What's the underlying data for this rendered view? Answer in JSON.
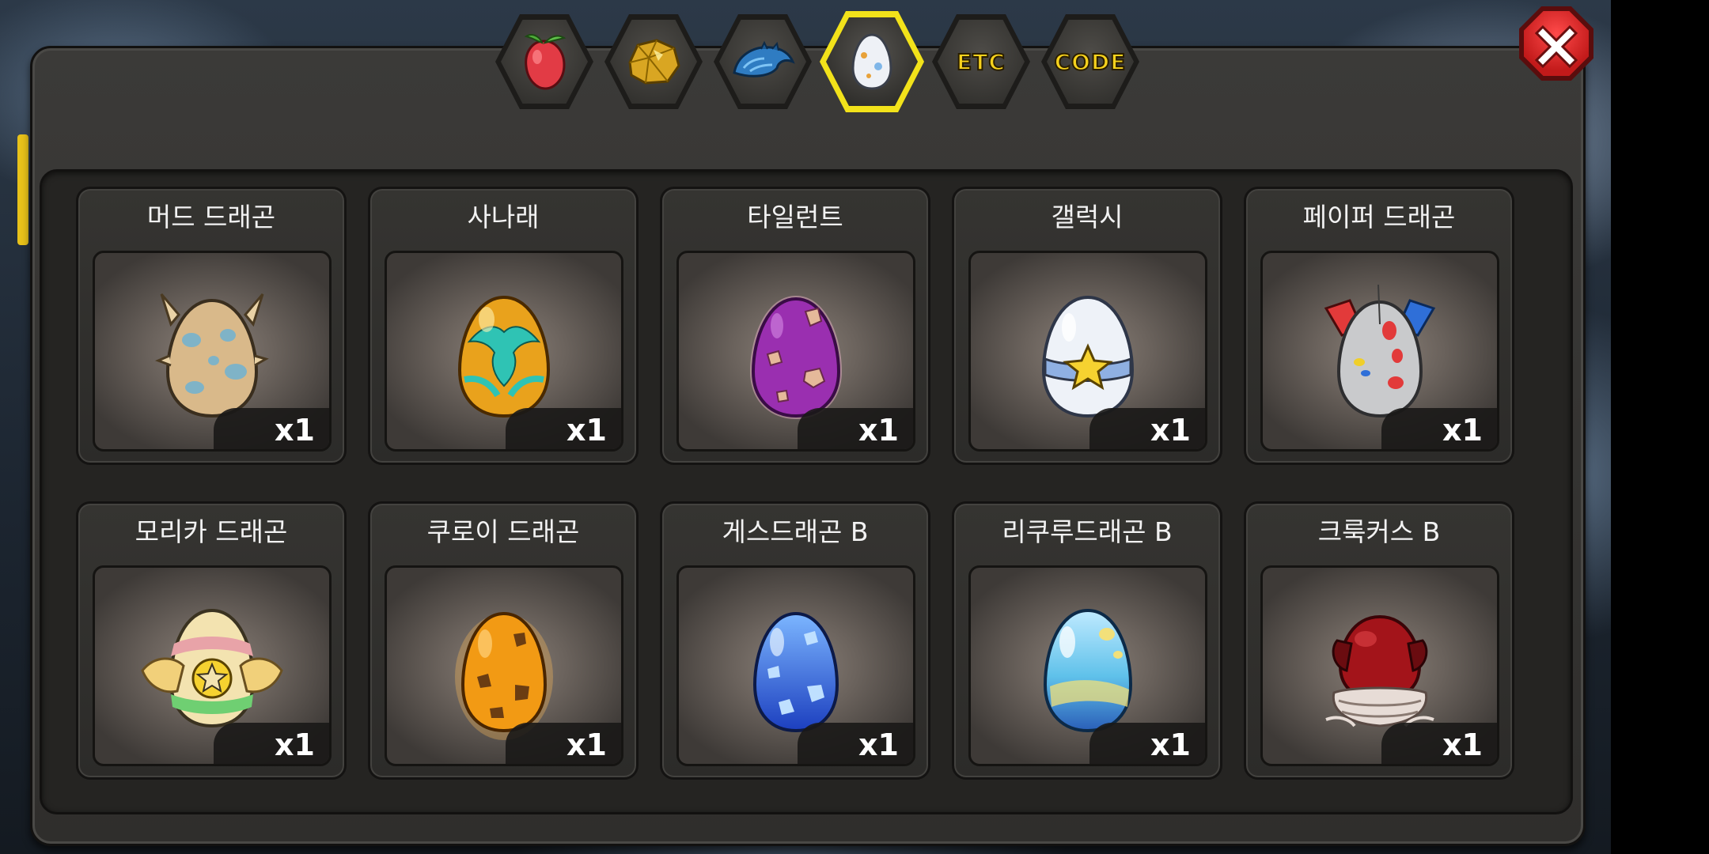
{
  "tabs": [
    {
      "icon": "fruit-icon",
      "label": "",
      "active": false
    },
    {
      "icon": "gold-nugget-icon",
      "label": "",
      "active": false
    },
    {
      "icon": "dragon-scale-icon",
      "label": "",
      "active": false
    },
    {
      "icon": "egg-icon",
      "label": "",
      "active": true
    },
    {
      "icon": "",
      "label": "ETC",
      "active": false
    },
    {
      "icon": "",
      "label": "CODE",
      "active": false
    }
  ],
  "eggs": [
    {
      "name": "머드 드래곤",
      "qty": "x1",
      "icon": "mud-dragon-egg-icon",
      "colors": [
        "#d9b98a",
        "#7fb3c7"
      ]
    },
    {
      "name": "사나래",
      "qty": "x1",
      "icon": "sanarae-egg-icon",
      "colors": [
        "#e9a21c",
        "#2fc3b4"
      ]
    },
    {
      "name": "타일런트",
      "qty": "x1",
      "icon": "tyrant-egg-icon",
      "colors": [
        "#9a2fb0",
        "#e5b99a"
      ]
    },
    {
      "name": "갤럭시",
      "qty": "x1",
      "icon": "galaxy-egg-icon",
      "colors": [
        "#eef2f8",
        "#8fb0e2"
      ]
    },
    {
      "name": "페이퍼 드래곤",
      "qty": "x1",
      "icon": "paper-dragon-egg-icon",
      "colors": [
        "#c9cacc",
        "#e23a3a"
      ]
    },
    {
      "name": "모리카 드래곤",
      "qty": "x1",
      "icon": "morika-dragon-egg-icon",
      "colors": [
        "#f3e3b0",
        "#e8a3a8"
      ]
    },
    {
      "name": "쿠로이 드래곤",
      "qty": "x1",
      "icon": "kuroi-dragon-egg-icon",
      "colors": [
        "#f29a14",
        "#6b3d12"
      ]
    },
    {
      "name": "게스드래곤 B",
      "qty": "x1",
      "icon": "gess-dragon-b-egg-icon",
      "colors": [
        "#2a63d8",
        "#bfe0ff"
      ]
    },
    {
      "name": "리쿠루드래곤 B",
      "qty": "x1",
      "icon": "rikuru-dragon-b-egg-icon",
      "colors": [
        "#5fc1ea",
        "#f2e07a"
      ]
    },
    {
      "name": "크룩커스 B",
      "qty": "x1",
      "icon": "crookers-b-egg-icon",
      "colors": [
        "#a3141a",
        "#e7dcd6"
      ]
    }
  ]
}
